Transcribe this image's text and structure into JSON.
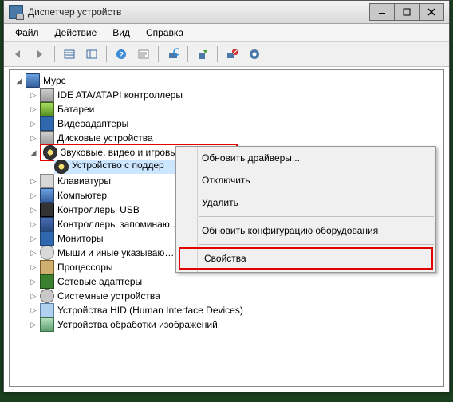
{
  "window": {
    "title": "Диспетчер устройств"
  },
  "menubar": [
    "Файл",
    "Действие",
    "Вид",
    "Справка"
  ],
  "tree": {
    "root": "Мурс",
    "items": [
      "IDE ATA/ATAPI контроллеры",
      "Батареи",
      "Видеоадаптеры",
      "Дисковые устройства",
      "Звуковые, видео и игровые устройства",
      "Клавиатуры",
      "Компьютер",
      "Контроллеры USB",
      "Контроллеры запоминаю…",
      "Мониторы",
      "Мыши и иные указываю…",
      "Процессоры",
      "Сетевые адаптеры",
      "Системные устройства",
      "Устройства HID (Human Interface Devices)",
      "Устройства обработки изображений"
    ],
    "sound_child": "Устройство с поддер"
  },
  "context_menu": [
    "Обновить драйверы...",
    "Отключить",
    "Удалить",
    "Обновить конфигурацию оборудования",
    "Свойства"
  ],
  "highlight_color": "#e10000"
}
